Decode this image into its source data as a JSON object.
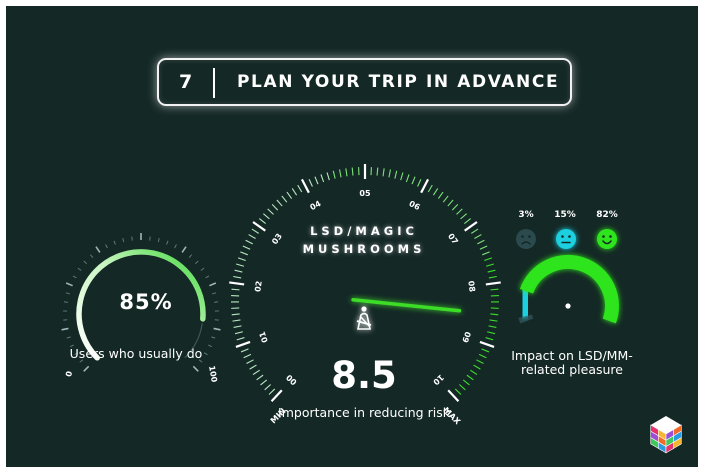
{
  "title": {
    "number": "7",
    "text": "PLAN YOUR TRIP IN ADVANCE"
  },
  "left_gauge": {
    "value_text": "85%",
    "value": 85,
    "min_label": "0",
    "max_label": "100",
    "caption": "Users who usually do",
    "color": "#6ee86a"
  },
  "center_gauge": {
    "title_line1": "LSD/MAGIC",
    "title_line2": "MUSHROOMS",
    "value_text": "8.5",
    "value": 8.5,
    "caption": "Importance in reducing risk",
    "icon": "seatbelt-icon",
    "min_label": "MIN",
    "max_label": "MAX",
    "tick_labels": [
      "00",
      "01",
      "02",
      "03",
      "04",
      "05",
      "06",
      "07",
      "08",
      "09",
      "10"
    ],
    "color": "#3cdc28"
  },
  "right_gauge": {
    "caption": "Impact on LSD/MM-related pleasure",
    "segments": [
      {
        "pct_text": "3%",
        "value": 3,
        "color": "#2a4a4e",
        "icon": "sad-face-icon"
      },
      {
        "pct_text": "15%",
        "value": 15,
        "color": "#1ed0e0",
        "icon": "neutral-face-icon"
      },
      {
        "pct_text": "82%",
        "value": 82,
        "color": "#2fe41e",
        "icon": "happy-face-icon"
      }
    ]
  },
  "logo": {
    "icon": "cube-logo-icon"
  }
}
